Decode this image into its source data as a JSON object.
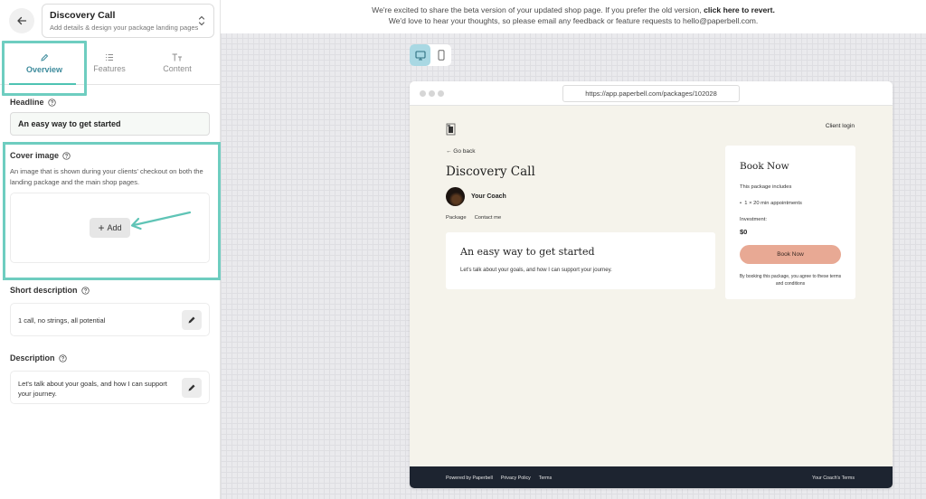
{
  "sidebar": {
    "package_title": "Discovery Call",
    "package_subtitle": "Add details & design your package landing pages",
    "tabs": [
      {
        "label": "Overview",
        "active": true,
        "icon": "pencil-icon"
      },
      {
        "label": "Features",
        "active": false,
        "icon": "list-icon"
      },
      {
        "label": "Content",
        "active": false,
        "icon": "text-format-icon"
      }
    ],
    "headline": {
      "label": "Headline",
      "value": "An easy way to get started"
    },
    "cover_image": {
      "label": "Cover image",
      "description": "An image that is shown during your clients' checkout on both the landing package and the main shop pages.",
      "add_label": "Add"
    },
    "short_description": {
      "label": "Short description",
      "value": "1 call, no strings, all potential"
    },
    "description": {
      "label": "Description",
      "value": "Let's talk about your goals, and how I can support your journey."
    }
  },
  "banner": {
    "text": "We're excited to share the beta version of your updated shop page. If you prefer the old version,",
    "link": "click here to revert",
    "line2": "We'd love to hear your thoughts, so please email any feedback or feature requests to hello@paperbell.com."
  },
  "preview": {
    "url": "https://app.paperbell.com/packages/102028",
    "client_login": "Client login",
    "go_back": "← Go back",
    "title": "Discovery Call",
    "coach_name": "Your Coach",
    "links": [
      "Package",
      "Contact me"
    ],
    "card_title": "An easy way to get started",
    "card_text": "Let's talk about your goals, and how I can support your journey.",
    "book": {
      "title": "Book Now",
      "includes": "This package includes",
      "item": "1 × 20 min appointments",
      "investment_label": "Investment:",
      "price": "$0",
      "button": "Book Now",
      "note": "By booking this package, you agree to these terms and conditions"
    },
    "footer": {
      "powered": "Powered by Paperbell",
      "privacy": "Privacy Policy",
      "terms": "Terms",
      "right": "Your Coach's Terms"
    }
  },
  "colors": {
    "accent_teal": "#6ecdc0",
    "tab_active": "#3d8b9c",
    "book_button": "#e8a994",
    "footer_bg": "#1d2430",
    "preview_bg": "#f5f3eb"
  }
}
